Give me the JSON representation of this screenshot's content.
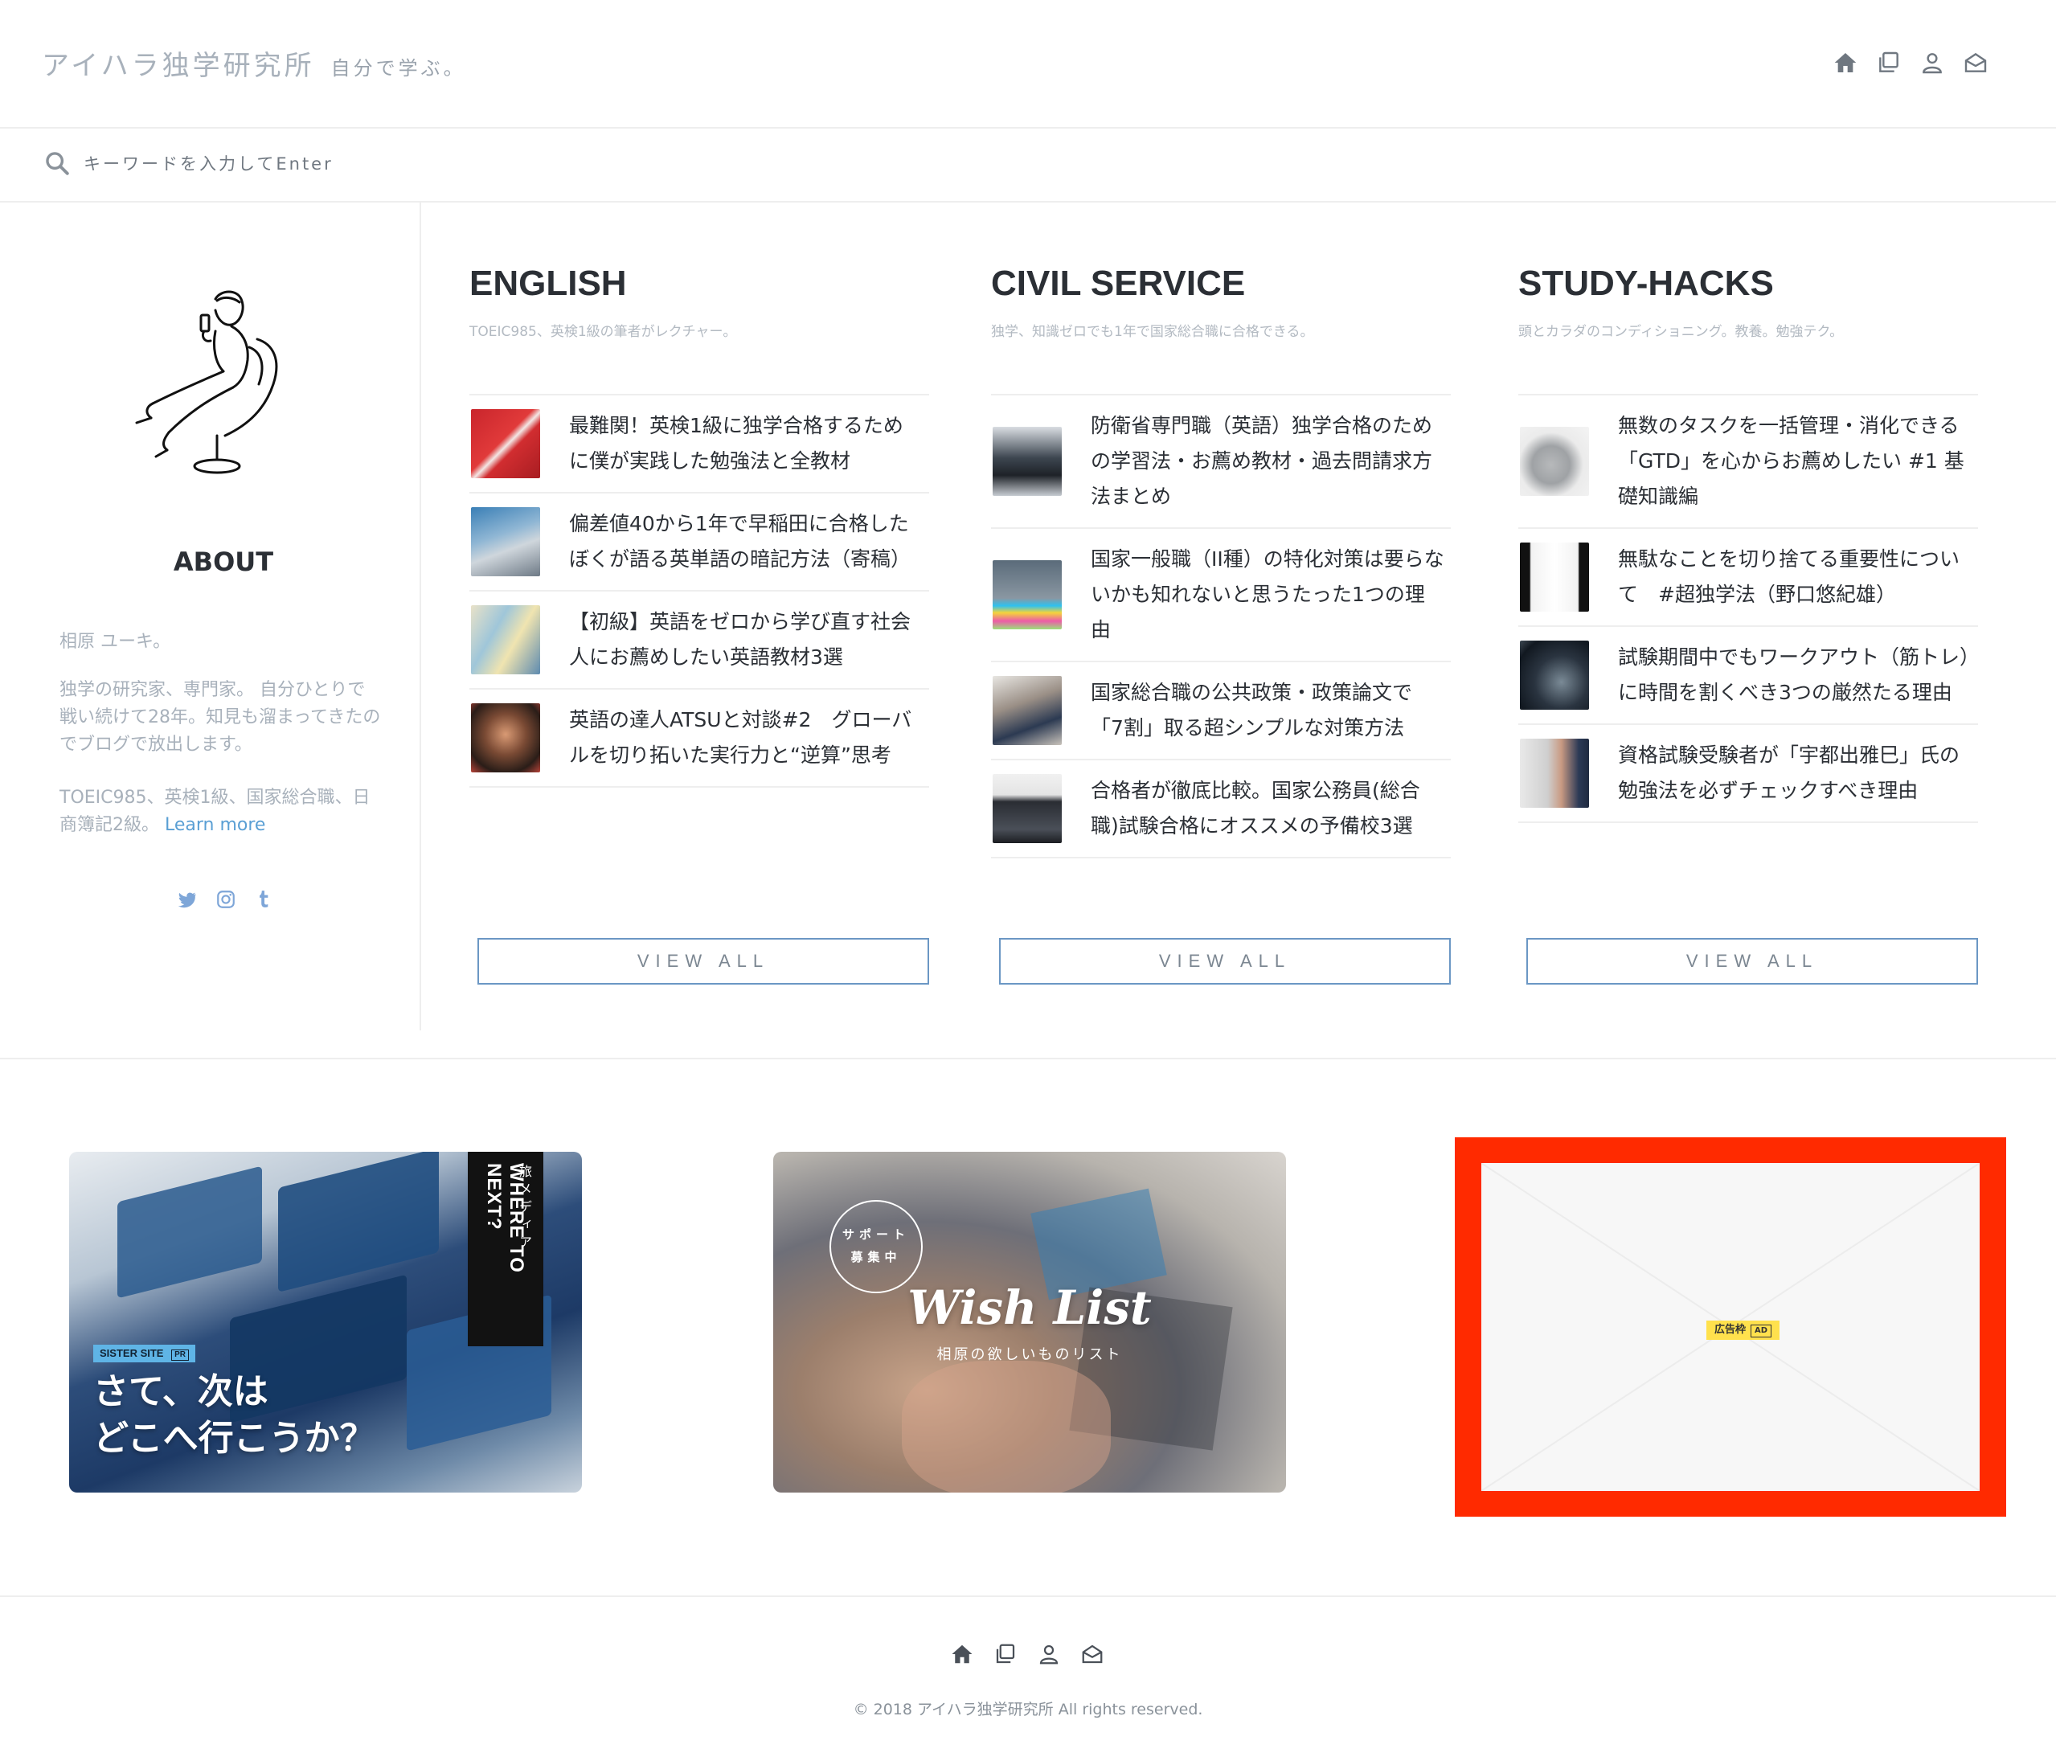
{
  "header": {
    "brand": "アイハラ独学研究所",
    "tagline": "自分で学ぶ。",
    "icons": [
      "home-icon",
      "copy-icon",
      "user-icon",
      "mail-icon"
    ]
  },
  "search": {
    "placeholder": "キーワードを入力してEnter"
  },
  "sidebar": {
    "about_title": "ABOUT",
    "name": "相原 ユーキ。",
    "description": "独学の研究家、専門家。 自分ひとりで戦い続けて28年。知見も溜まってきたのでブログで放出します。",
    "credentials": "TOEIC985、英検1級、国家総合職、日商簿記2級。",
    "learn_more": "Learn more",
    "social": [
      "twitter-icon",
      "instagram-icon",
      "tumblr-icon"
    ]
  },
  "columns": [
    {
      "title": "ENGLISH",
      "subtitle": "TOEIC985、英検1級の筆者がレクチャー。",
      "items": [
        {
          "text": "最難関！英検1級に独学合格するために僕が実践した勉強法と全教材"
        },
        {
          "text": "偏差値40から1年で早稲田に合格したぼくが語る英単語の暗記方法（寄稿）"
        },
        {
          "text": "【初級】英語をゼロから学び直す社会人にお薦めしたい英語教材3選"
        },
        {
          "text": "英語の達人ATSUと対談#2　グローバルを切り拓いた実行力と“逆算”思考"
        }
      ],
      "view_all": "VIEW ALL"
    },
    {
      "title": "CIVIL SERVICE",
      "subtitle": "独学、知識ゼロでも1年で国家総合職に合格できる。",
      "items": [
        {
          "text": "防衛省専門職（英語）独学合格のための学習法・お薦め教材・過去問請求方法まとめ"
        },
        {
          "text": "国家一般職（II種）の特化対策は要らないかも知れないと思うたった1つの理由"
        },
        {
          "text": "国家総合職の公共政策・政策論文で「7割」取る超シンプルな対策方法"
        },
        {
          "text": "合格者が徹底比較。国家公務員(総合職)試験合格にオススメの予備校3選"
        }
      ],
      "view_all": "VIEW ALL"
    },
    {
      "title": "STUDY-HACKS",
      "subtitle": "頭とカラダのコンディショニング。教養。勉強テク。",
      "items": [
        {
          "text": "無数のタスクを一括管理・消化できる「GTD」を心からお薦めしたい #1 基礎知識編"
        },
        {
          "text": "無駄なことを切り捨てる重要性について　#超独学法（野口悠紀雄）"
        },
        {
          "text": "試験期間中でもワークアウト（筋トレ）に時間を割くべき3つの厳然たる理由"
        },
        {
          "text": "資格試験受験者が「宇都出雅巳」氏の勉強法を必ずチェックすべき理由"
        }
      ],
      "view_all": "VIEW ALL"
    }
  ],
  "banners": {
    "sister_site": {
      "badge": "SISTER SITE",
      "pr": "PR",
      "line1": "さて、次は",
      "line2": "どこへ行こうか？",
      "vertical_small": "旅メディア",
      "vertical_title": "WHERE TO NEXT?"
    },
    "wishlist": {
      "bubble_line1": "サポート",
      "bubble_line2": "募集中",
      "title": "Wish List",
      "subtitle": "相原の欲しいものリスト"
    },
    "ad": {
      "label": "広告枠",
      "tag": "AD"
    }
  },
  "footer": {
    "icons": [
      "home-icon",
      "copy-icon",
      "user-icon",
      "mail-icon"
    ],
    "copyright": "© 2018 アイハラ独学研究所 All rights reserved."
  }
}
